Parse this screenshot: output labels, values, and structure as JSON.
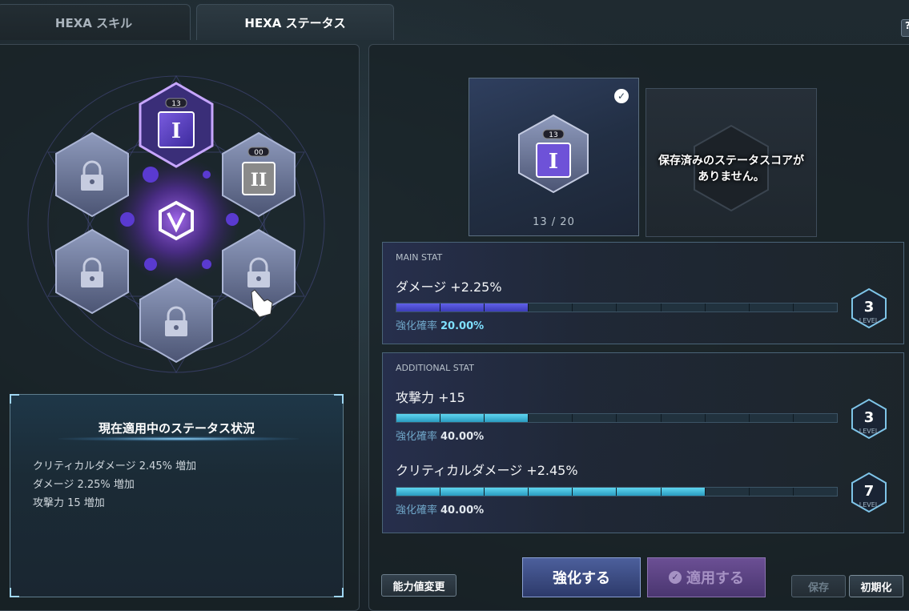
{
  "tabs": {
    "skill": "HEXA スキル",
    "status": "HEXA ステータス",
    "help": "?"
  },
  "hex_grid": {
    "active_core": {
      "level": "13",
      "glyph": "I"
    },
    "second_core": {
      "level": "00",
      "glyph": "II"
    },
    "locked_count": 4,
    "center_icon": "vi-emblem-icon"
  },
  "status_box": {
    "title": "現在適用中のステータス状況",
    "lines": [
      "クリティカルダメージ 2.45% 増加",
      "ダメージ 2.25% 増加",
      "攻撃力 15 増加"
    ]
  },
  "core_card": {
    "level": "13",
    "glyph": "I",
    "progress": "13 / 20"
  },
  "saved_card": {
    "line1": "保存済みのステータスコアが",
    "line2": "ありません。"
  },
  "main_stat": {
    "header": "MAIN STAT",
    "label": "ダメージ +2.25%",
    "rate_label": "強化確率",
    "rate_value": "20.00%",
    "level": "3",
    "level_label": "LEVEL",
    "filled": 3,
    "total": 10
  },
  "additional_stat": {
    "header": "ADDITIONAL STAT",
    "items": [
      {
        "label": "攻撃力 +15",
        "rate_label": "強化確率",
        "rate_value": "40.00%",
        "level": "3",
        "level_label": "LEVEL",
        "filled": 3,
        "total": 10
      },
      {
        "label": "クリティカルダメージ +2.45%",
        "rate_label": "強化確率",
        "rate_value": "40.00%",
        "level": "7",
        "level_label": "LEVEL",
        "filled": 7,
        "total": 10
      }
    ]
  },
  "buttons": {
    "reroll": "能力値変更",
    "enhance": "強化する",
    "apply": "適用する",
    "save": "保存",
    "reset": "初期化"
  },
  "colors": {
    "purple_accent": "#9b6cf0",
    "cyan_bar": "#4fc8e8",
    "purple_bar": "#5050d8"
  }
}
